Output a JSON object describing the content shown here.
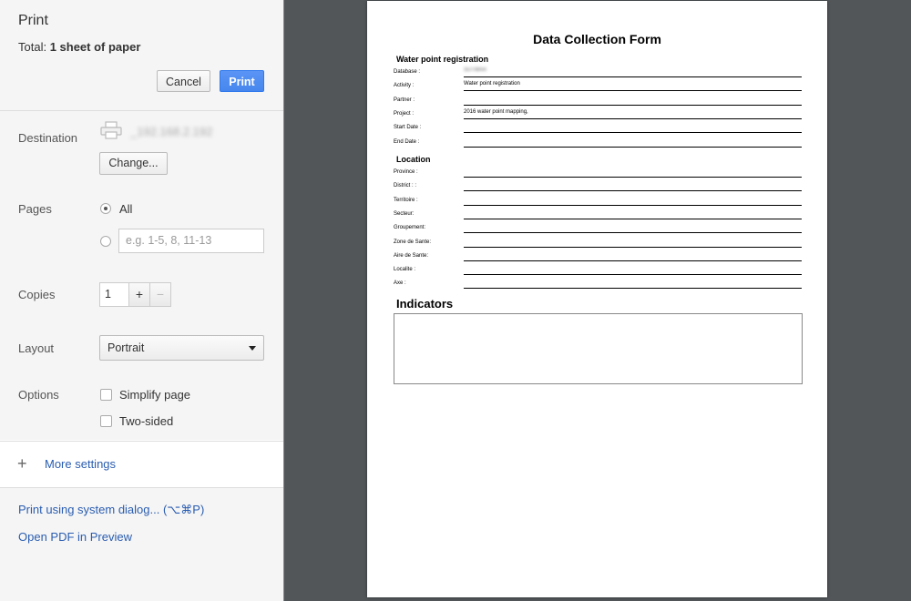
{
  "dialog": {
    "title": "Print",
    "total_label": "Total: ",
    "total_value": "1 sheet of paper",
    "cancel_label": "Cancel",
    "print_label": "Print"
  },
  "destination": {
    "label": "Destination",
    "printer_name": "_192.168.2.192",
    "change_label": "Change..."
  },
  "pages": {
    "label": "Pages",
    "all_label": "All",
    "range_placeholder": "e.g. 1-5, 8, 11-13"
  },
  "copies": {
    "label": "Copies",
    "value": "1",
    "plus": "+",
    "minus": "−"
  },
  "layout": {
    "label": "Layout",
    "selected": "Portrait"
  },
  "options": {
    "label": "Options",
    "simplify_label": "Simplify page",
    "two_sided_label": "Two-sided"
  },
  "more_settings": {
    "label": "More settings"
  },
  "footer": {
    "system_dialog_label": "Print using system dialog... (⌥⌘P)",
    "open_pdf_label": "Open PDF in Preview"
  },
  "preview": {
    "form_title": "Data Collection Form",
    "section1_title": "Water point registration",
    "fields1": [
      {
        "label": "Database :",
        "value": "SUTMAA"
      },
      {
        "label": "Activity :",
        "value": "Water point registration"
      },
      {
        "label": "Partner :",
        "value": ""
      },
      {
        "label": "Project :",
        "value": "2016 water point mapping,"
      },
      {
        "label": "Start Date :",
        "value": ""
      },
      {
        "label": "End Date :",
        "value": ""
      }
    ],
    "section2_title": "Location",
    "fields2": [
      {
        "label": "Province :"
      },
      {
        "label": "District : :"
      },
      {
        "label": "Territoire :"
      },
      {
        "label": "Secteur:"
      },
      {
        "label": "Groupement:"
      },
      {
        "label": "Zone de Sante:"
      },
      {
        "label": "Aire de Sante:"
      },
      {
        "label": "Localite :"
      },
      {
        "label": "Axe :"
      }
    ],
    "section3_title": "Indicators"
  }
}
